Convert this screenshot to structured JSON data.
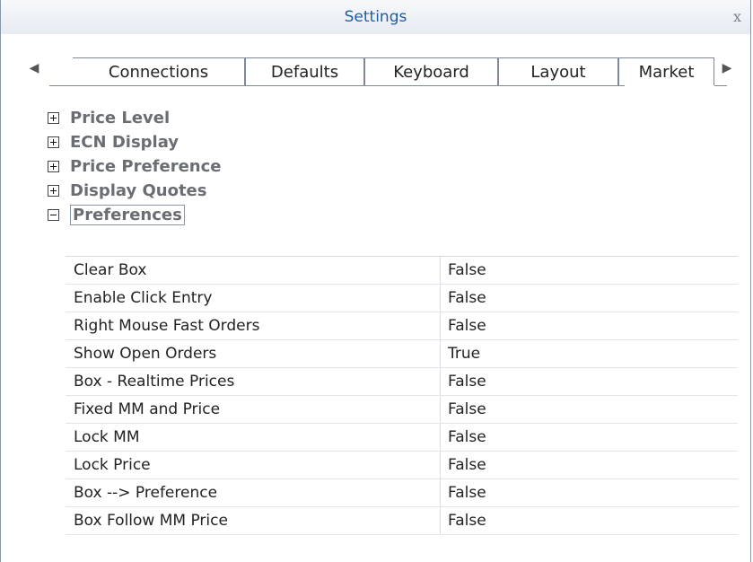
{
  "window": {
    "title": "Settings",
    "close_label": "x"
  },
  "tabs": {
    "scroll_left": "◀",
    "scroll_right": "▶",
    "items": [
      {
        "label": "Connections"
      },
      {
        "label": "Defaults"
      },
      {
        "label": "Keyboard"
      },
      {
        "label": "Layout"
      },
      {
        "label": "Market",
        "active": true
      }
    ]
  },
  "tree": {
    "nodes": [
      {
        "label": "Price Level",
        "expanded": false
      },
      {
        "label": "ECN Display",
        "expanded": false
      },
      {
        "label": "Price Preference",
        "expanded": false
      },
      {
        "label": "Display Quotes",
        "expanded": false
      },
      {
        "label": "Preferences",
        "expanded": true
      }
    ]
  },
  "preferences": {
    "rows": [
      {
        "name": "Clear Box",
        "value": "False"
      },
      {
        "name": "Enable Click Entry",
        "value": "False"
      },
      {
        "name": "Right Mouse Fast Orders",
        "value": "False"
      },
      {
        "name": "Show Open Orders",
        "value": "True"
      },
      {
        "name": "Box - Realtime Prices",
        "value": "False"
      },
      {
        "name": "Fixed MM and Price",
        "value": "False"
      },
      {
        "name": "Lock MM",
        "value": "False"
      },
      {
        "name": "Lock Price",
        "value": "False"
      },
      {
        "name": "Box --> Preference",
        "value": "False"
      },
      {
        "name": "Box Follow MM Price",
        "value": "False"
      }
    ]
  }
}
